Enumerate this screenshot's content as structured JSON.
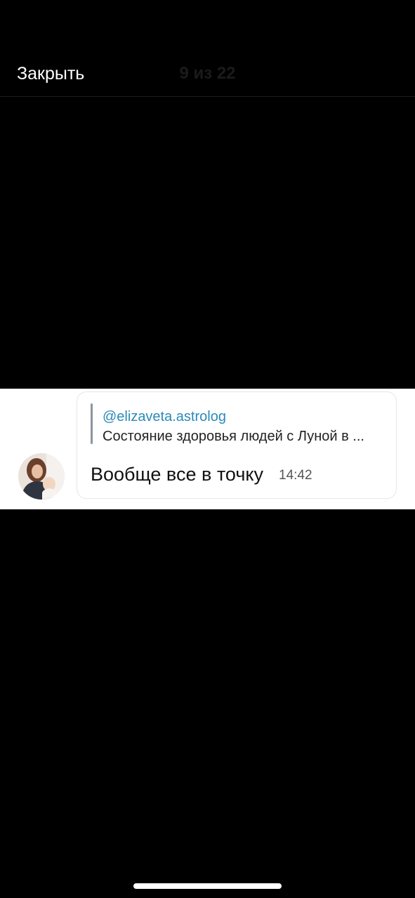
{
  "header": {
    "close_label": "Закрыть",
    "counter": "9 из 22"
  },
  "message": {
    "reply_author": "@elizaveta.astrolog",
    "reply_text": "Состояние здоровья людей с Луной в ...",
    "text": "Вообще все в точку",
    "time": "14:42"
  },
  "colors": {
    "background": "#000000",
    "reply_author": "#2a8bb7",
    "bubble_border": "#e3e6ea"
  },
  "icons": {
    "avatar": "avatar-photo"
  }
}
